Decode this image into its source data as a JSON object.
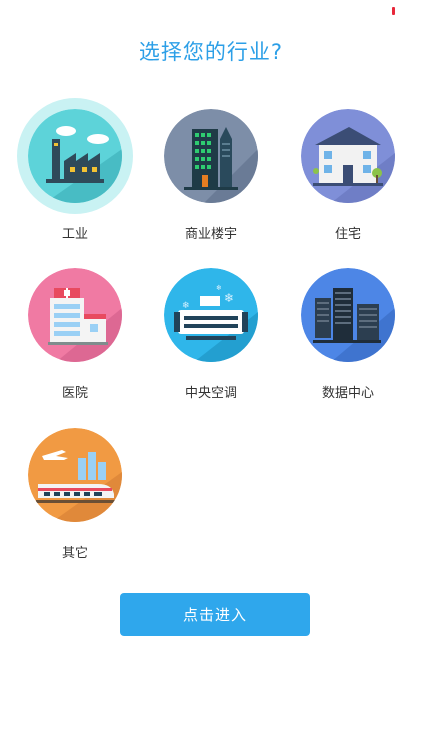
{
  "title": "选择您的行业?",
  "industries": [
    {
      "label": "工业",
      "icon": "factory-icon",
      "selected": true
    },
    {
      "label": "商业楼宇",
      "icon": "office-building-icon",
      "selected": false
    },
    {
      "label": "住宅",
      "icon": "house-icon",
      "selected": false
    },
    {
      "label": "医院",
      "icon": "hospital-icon",
      "selected": false
    },
    {
      "label": "中央空调",
      "icon": "air-conditioner-icon",
      "selected": false
    },
    {
      "label": "数据中心",
      "icon": "server-rack-icon",
      "selected": false
    },
    {
      "label": "其它",
      "icon": "train-plane-icon",
      "selected": false
    }
  ],
  "enter_button": {
    "label": "点击进入"
  },
  "colors": {
    "accent": "#2c9fe7",
    "button": "#2fa7ec",
    "factory_bg": "#5dd3d9",
    "building_bg": "#7d8ea8",
    "house_bg": "#7f8fd8",
    "hospital_bg": "#f07aa3",
    "ac_bg": "#2fb6ea",
    "datacenter_bg": "#4d86e6",
    "other_bg": "#f19a43"
  }
}
